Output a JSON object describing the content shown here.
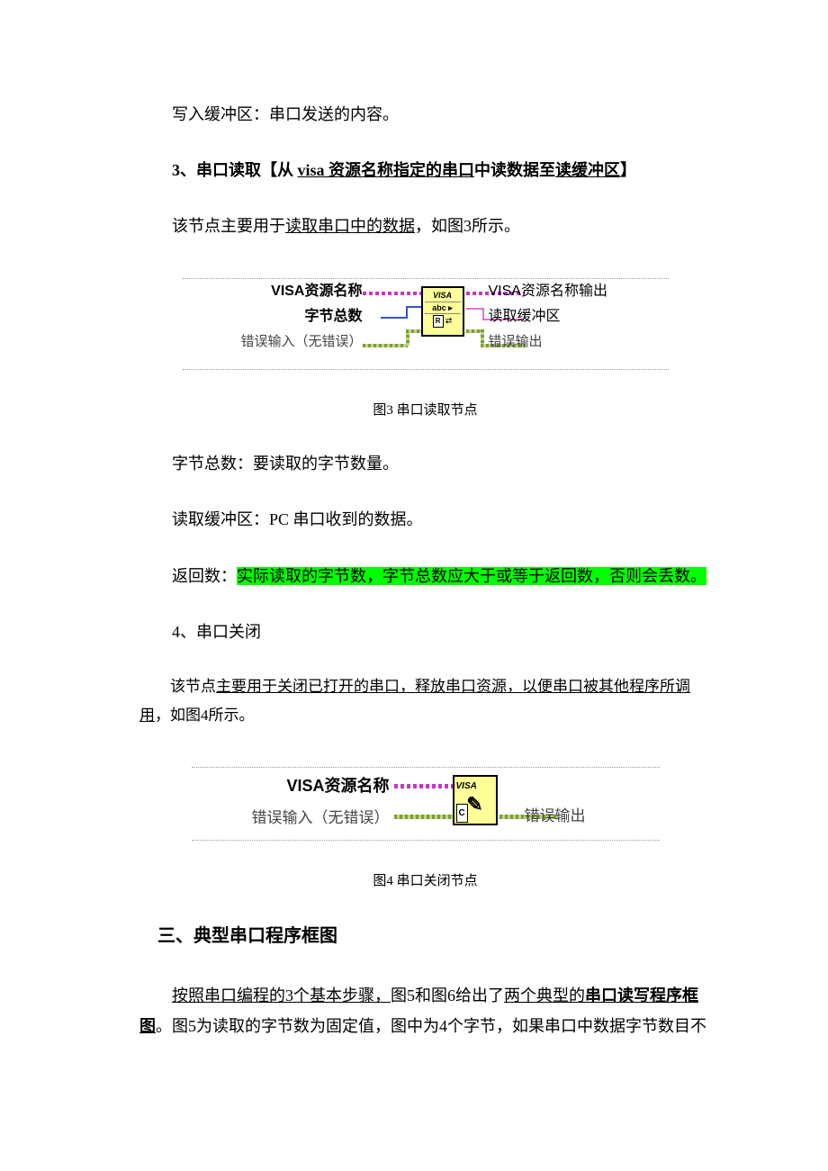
{
  "para1": "写入缓冲区：串口发送的内容。",
  "section3": {
    "prefix": "3、串口读取【从 ",
    "u1": "visa 资源名称指定的串口",
    "mid1": "中读数据至",
    "u2": "读缓冲区",
    "suffix": "】"
  },
  "para2": {
    "prefix": "该节点主要用于",
    "u": "读取串口中的数据",
    "suffix": "，如图3所示。"
  },
  "fig3": {
    "left1": "VISA资源名称",
    "left2": "字节总数",
    "left3": "错误输入（无错误）",
    "right1": "VISA资源名称输出",
    "right2": "读取缓冲区",
    "right3": "错误输出",
    "block_top": "VISA",
    "block_mid": "abc ▸",
    "block_r": "R",
    "caption": "图3 串口读取节点"
  },
  "para3": "字节总数：要读取的字节数量。",
  "para4": "读取缓冲区：PC 串口收到的数据。",
  "para5": {
    "prefix": "返回数：",
    "hl": "实际读取的字节数，字节总数应大于或等于返回数，否则会丢数。"
  },
  "para6": "4、串口关闭",
  "para7": {
    "prefix": "该节点",
    "u": "主要用于关闭已打开的串口，释放串口资源，以便串口被其他程序所调用",
    "suffix": "，如图4所示。"
  },
  "fig4": {
    "left1": "VISA资源名称",
    "left2": "错误输入（无错误）",
    "right": "错误输出",
    "block_text": "VISA",
    "block_c": "C",
    "caption": "图4 串口关闭节点"
  },
  "heading": "三、典型串口程序框图",
  "para8": {
    "u1": "按照串口编程的3个基本步骤，",
    "mid": "图5和图6给出了",
    "u2": "两个典型的",
    "b": "串口读写程序框图",
    "suffix": "。图5为读取的字节数为固定值，图中为4个字节，如果串口中数据字节数目不"
  }
}
